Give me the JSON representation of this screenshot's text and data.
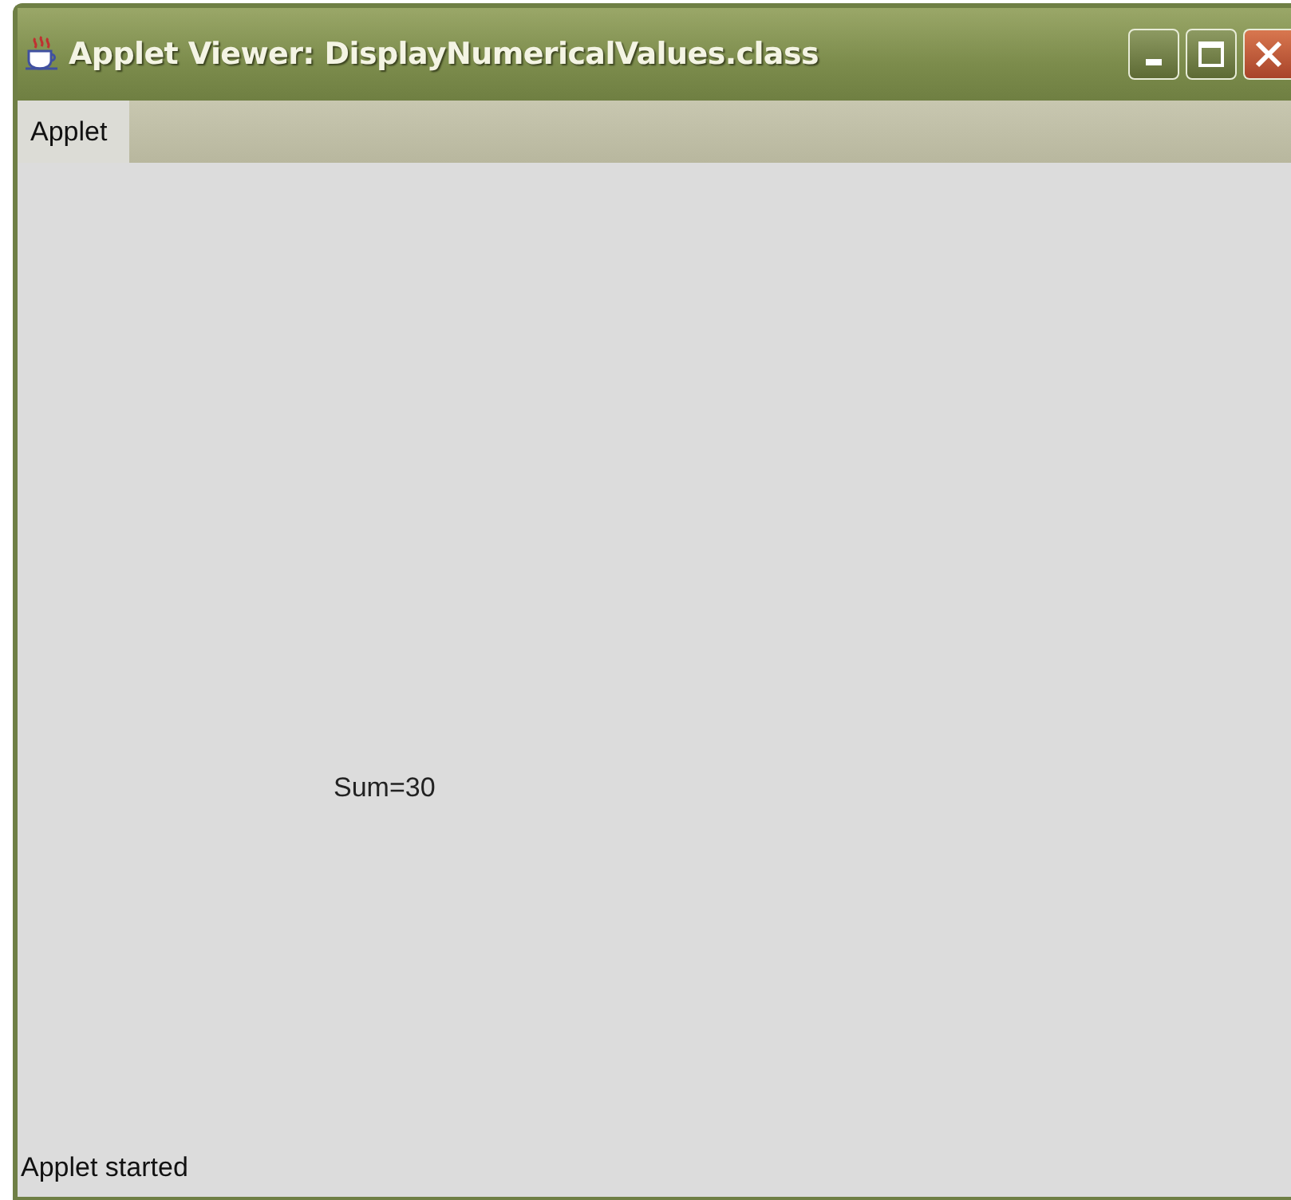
{
  "window": {
    "title": "Applet Viewer: DisplayNumericalValues.class"
  },
  "menu_bar": {
    "items": [
      {
        "label": "Applet"
      }
    ]
  },
  "applet": {
    "text": "Sum=30"
  },
  "status_bar": {
    "text": "Applet started"
  }
}
